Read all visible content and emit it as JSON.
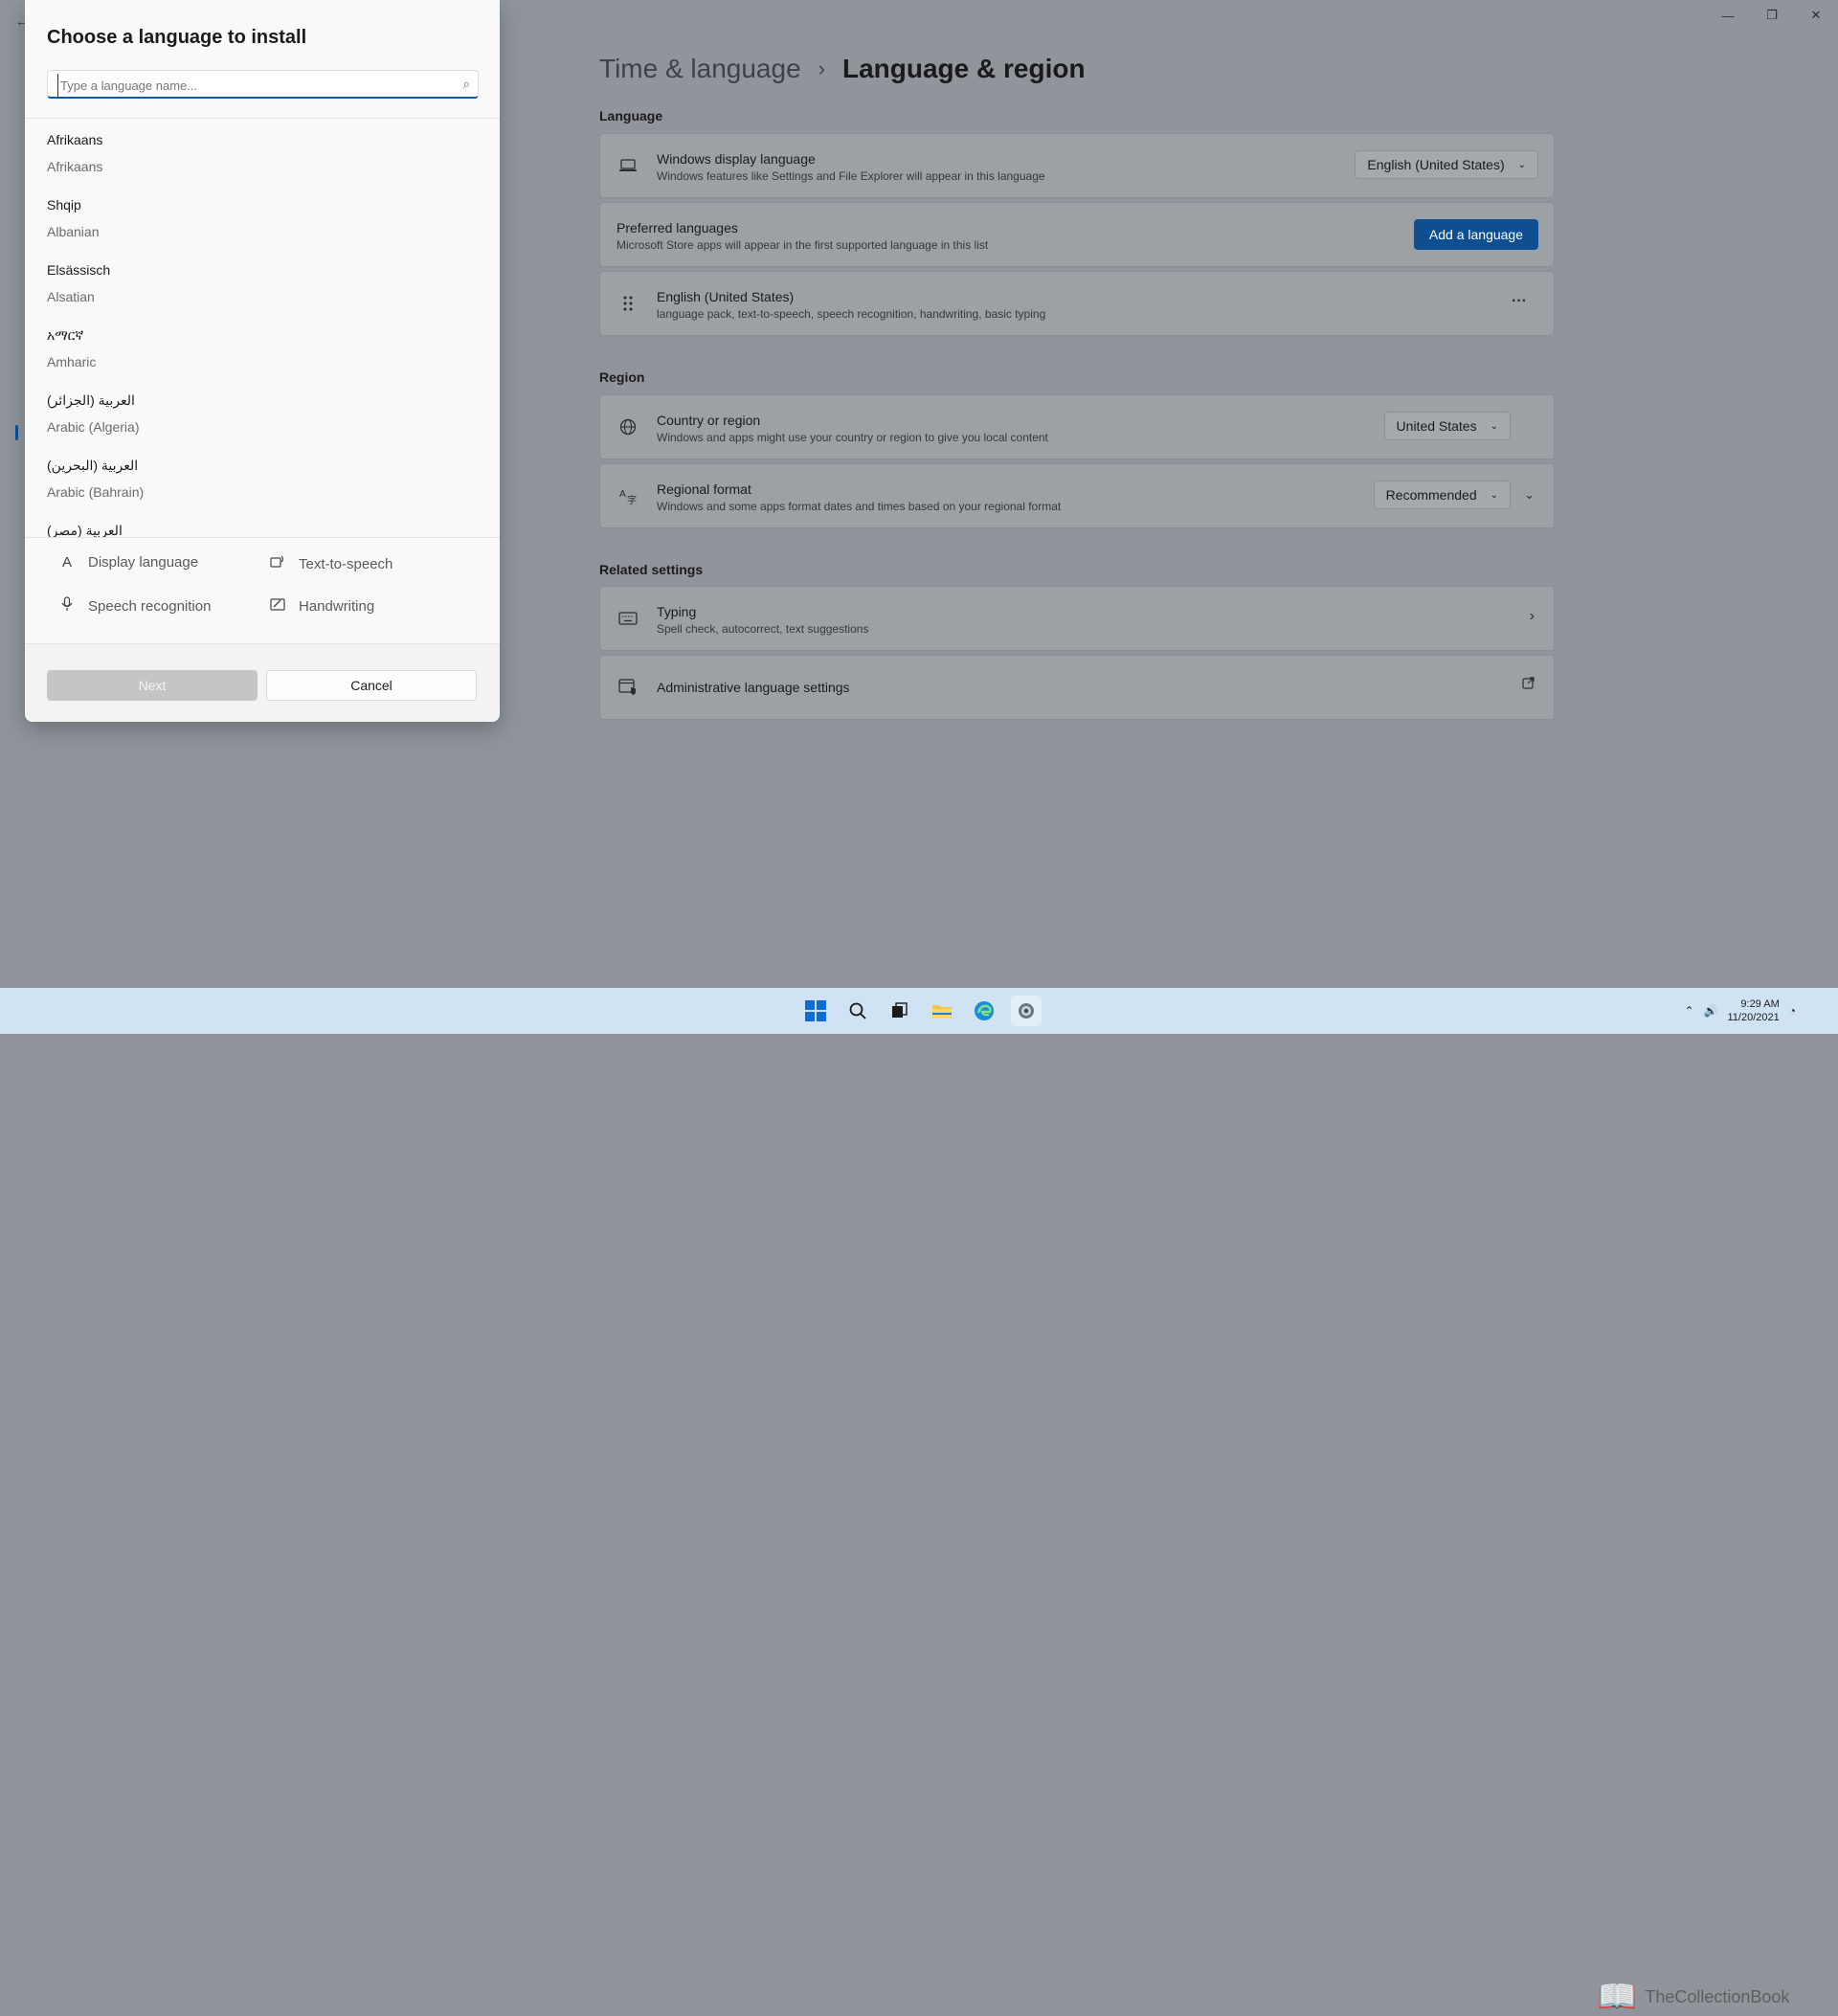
{
  "window": {
    "minimize_glyph": "—",
    "maximize_glyph": "❐",
    "close_glyph": "✕",
    "back_glyph": "←"
  },
  "settings": {
    "breadcrumb_parent": "Time & language",
    "breadcrumb_separator": "›",
    "breadcrumb_current": "Language & region",
    "section_language": "Language",
    "display_language": {
      "title": "Windows display language",
      "subtitle": "Windows features like Settings and File Explorer will appear in this language",
      "value": "English (United States)",
      "icon": "laptop-icon"
    },
    "preferred_languages": {
      "title": "Preferred languages",
      "subtitle": "Microsoft Store apps will appear in the first supported language in this list",
      "button": "Add a language"
    },
    "installed_language": {
      "title": "English (United States)",
      "subtitle": "language pack, text-to-speech, speech recognition, handwriting, basic typing",
      "more_glyph": "···",
      "icon": "drag-handle-icon"
    },
    "section_region": "Region",
    "country": {
      "title": "Country or region",
      "subtitle": "Windows and apps might use your country or region to give you local content",
      "value": "United States",
      "icon": "globe-icon"
    },
    "regional_format": {
      "title": "Regional format",
      "subtitle": "Windows and some apps format dates and times based on your regional format",
      "value": "Recommended",
      "icon": "regional-format-icon"
    },
    "section_related": "Related settings",
    "typing": {
      "title": "Typing",
      "subtitle": "Spell check, autocorrect, text suggestions",
      "icon": "keyboard-icon"
    },
    "admin": {
      "title": "Administrative language settings",
      "icon": "admin-language-icon"
    }
  },
  "dialog": {
    "title": "Choose a language to install",
    "search_placeholder": "Type a language name...",
    "languages": [
      {
        "native": "Afrikaans",
        "english": "Afrikaans"
      },
      {
        "native": "Shqip",
        "english": "Albanian"
      },
      {
        "native": "Elsässisch",
        "english": "Alsatian"
      },
      {
        "native": "አማርኛ",
        "english": "Amharic"
      },
      {
        "native": "العربية (الجزائر)",
        "english": "Arabic (Algeria)"
      },
      {
        "native": "العربية (البحرين)",
        "english": "Arabic (Bahrain)"
      },
      {
        "native": "العربية (مصر)",
        "english": ""
      }
    ],
    "features": {
      "display_language": "Display language",
      "text_to_speech": "Text-to-speech",
      "speech_recognition": "Speech recognition",
      "handwriting": "Handwriting"
    },
    "next_button": "Next",
    "cancel_button": "Cancel"
  },
  "taskbar": {
    "time": "9:29 AM",
    "date": "11/20/2021",
    "watermark": "TheCollectionBook"
  },
  "colors": {
    "accent": "#0e4f92",
    "overlay_background": "#8f959b",
    "dialog_background": "#f9f9f9",
    "taskbar": "#cfe3f4"
  }
}
